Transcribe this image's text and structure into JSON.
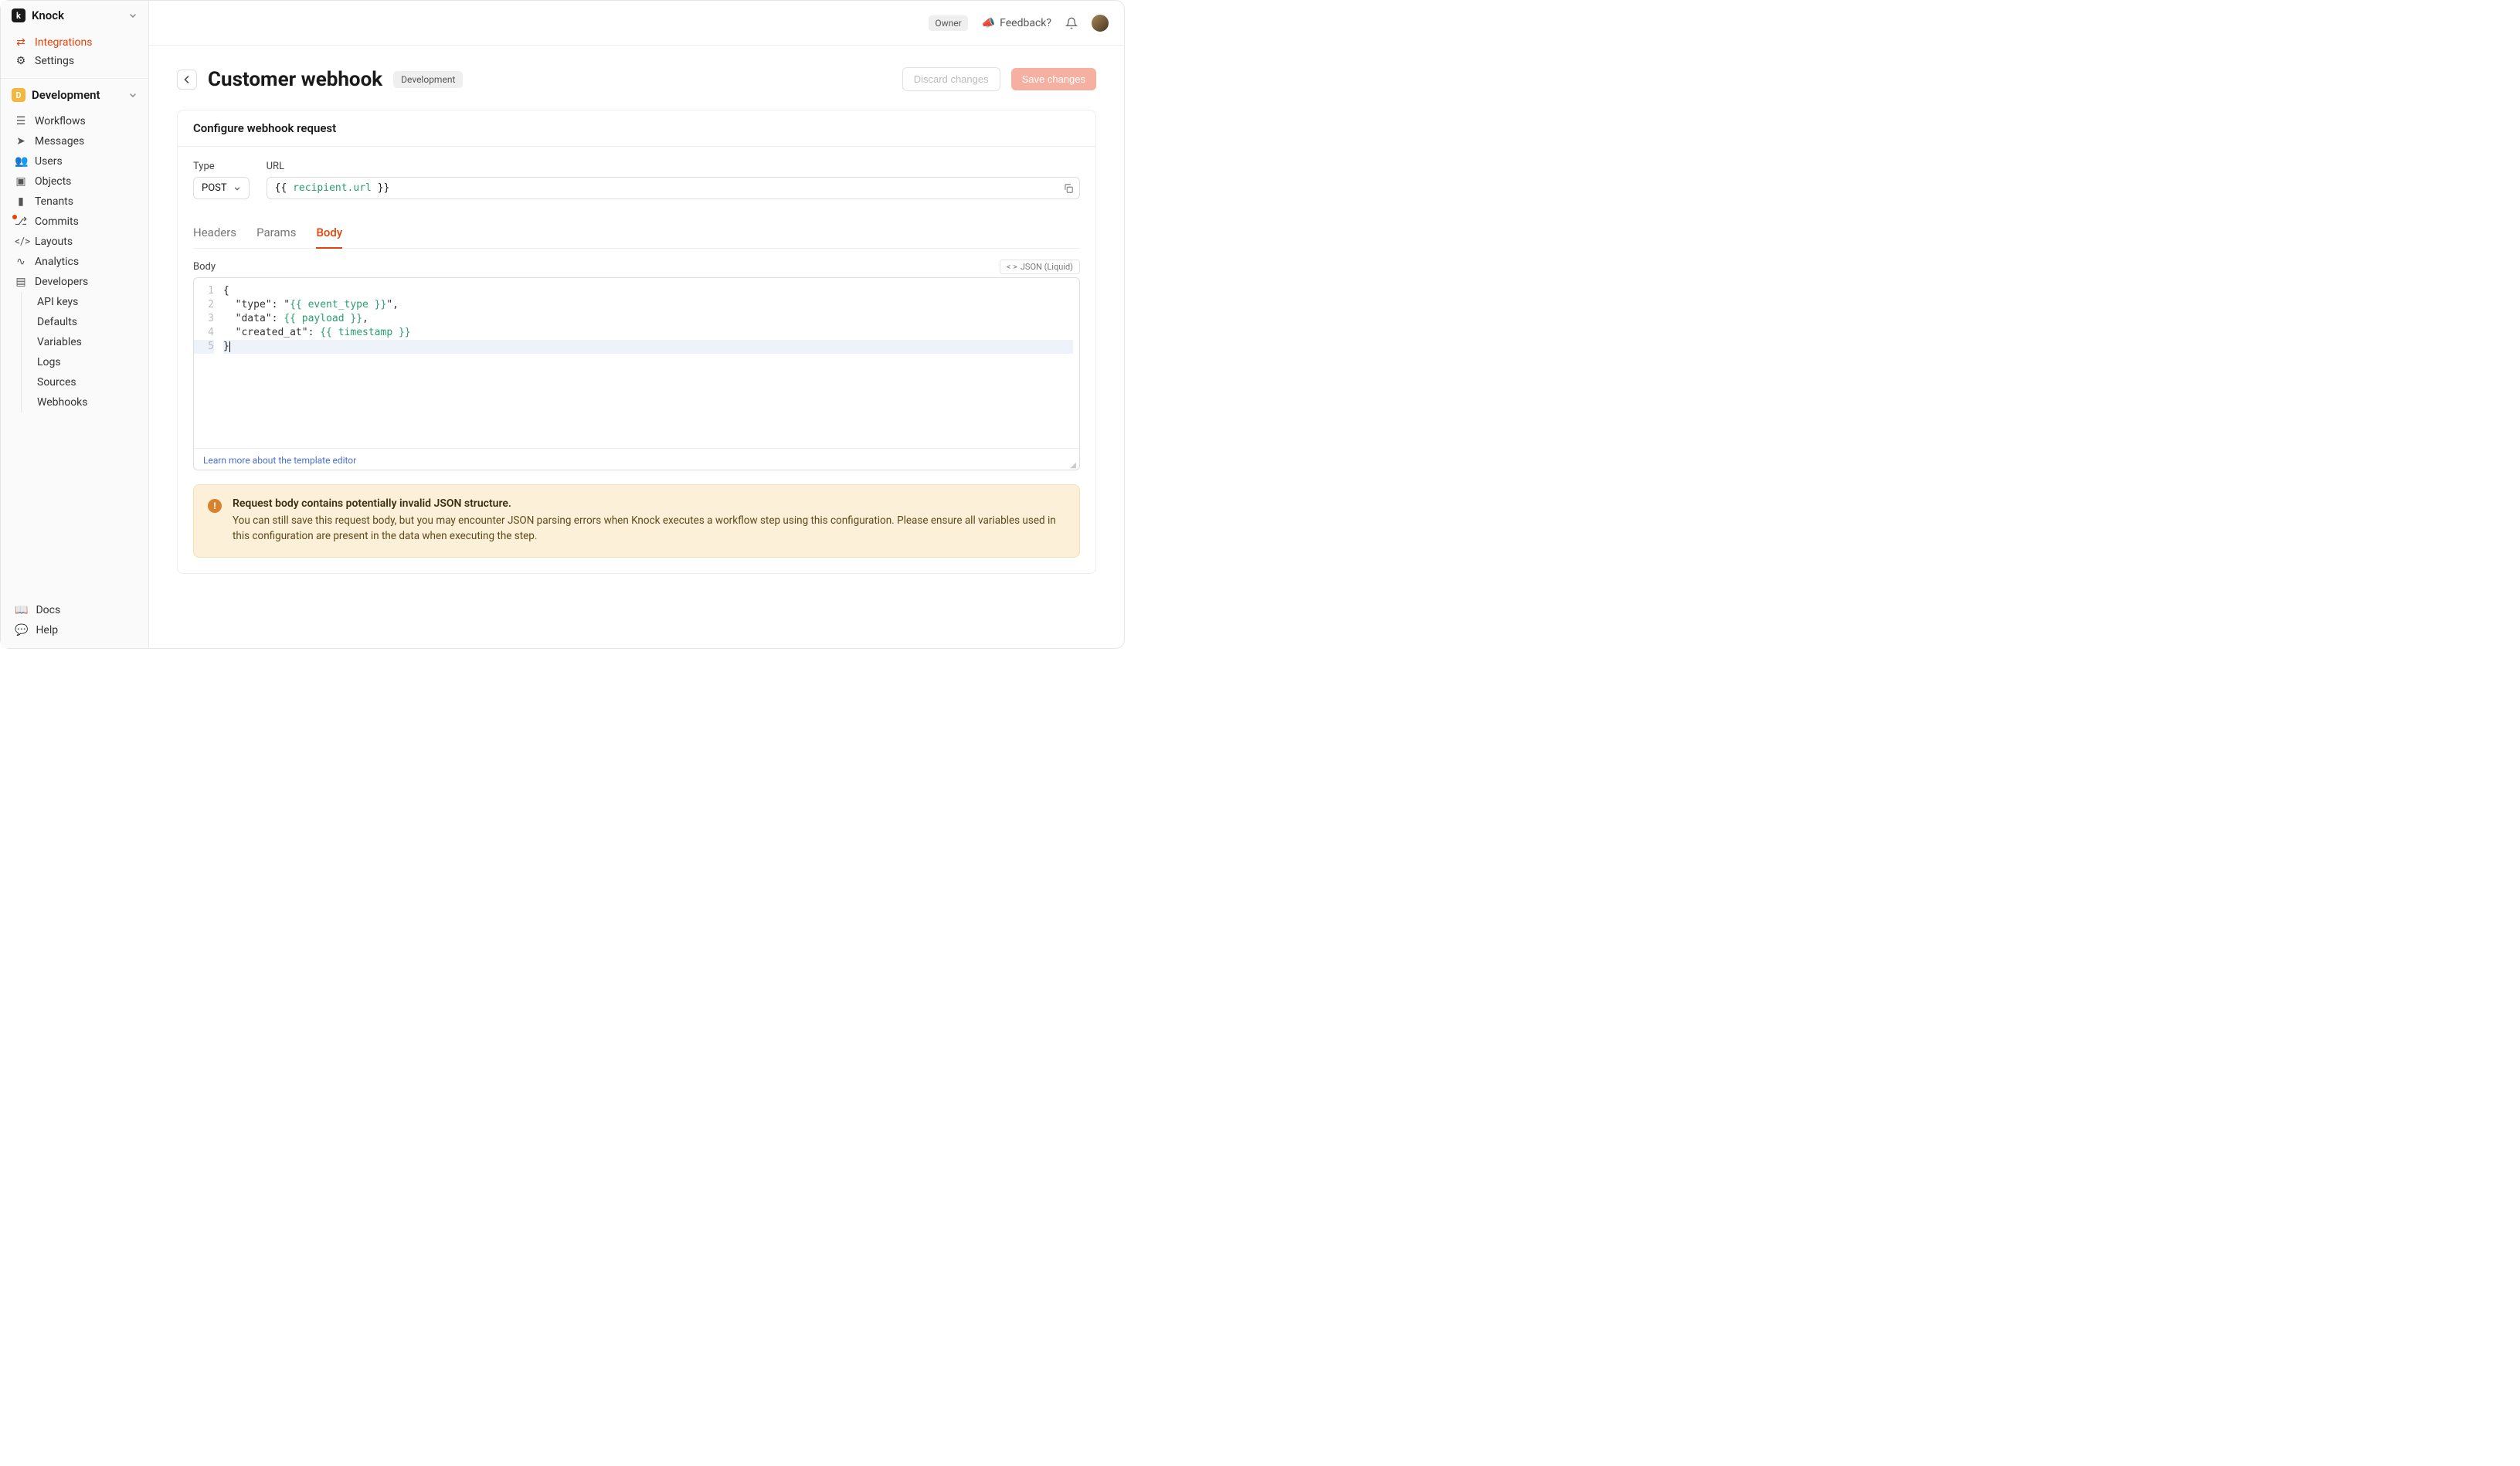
{
  "brand": "Knock",
  "topnav": {
    "integrations": "Integrations",
    "settings": "Settings"
  },
  "environment": {
    "letter": "D",
    "name": "Development"
  },
  "nav": {
    "workflows": "Workflows",
    "messages": "Messages",
    "users": "Users",
    "objects": "Objects",
    "tenants": "Tenants",
    "commits": "Commits",
    "layouts": "Layouts",
    "analytics": "Analytics",
    "developers": "Developers"
  },
  "devSub": {
    "apikeys": "API keys",
    "defaults": "Defaults",
    "variables": "Variables",
    "logs": "Logs",
    "sources": "Sources",
    "webhooks": "Webhooks"
  },
  "footer": {
    "docs": "Docs",
    "help": "Help"
  },
  "topbar": {
    "owner": "Owner",
    "feedback": "Feedback?"
  },
  "page": {
    "title": "Customer webhook",
    "env": "Development",
    "discard": "Discard changes",
    "save": "Save changes"
  },
  "panel": {
    "title": "Configure webhook request",
    "typeLabel": "Type",
    "typeValue": "POST",
    "urlLabel": "URL",
    "urlValuePrefix": "{{ ",
    "urlValueVar": "recipient.url",
    "urlValueSuffix": " }}"
  },
  "tabs": {
    "headers": "Headers",
    "params": "Params",
    "body": "Body"
  },
  "bodySection": {
    "label": "Body",
    "lang": "JSON (Liquid)",
    "learn": "Learn more about the template editor"
  },
  "code": {
    "l1": "{",
    "l2a": "  \"type\": \"",
    "l2v": "{{ event_type }}",
    "l2b": "\",",
    "l3a": "  \"data\": ",
    "l3v": "{{ payload }}",
    "l3b": ",",
    "l4a": "  \"created_at\": ",
    "l4v": "{{ timestamp }}",
    "l5": "}"
  },
  "alert": {
    "title": "Request body contains potentially invalid JSON structure.",
    "body": "You can still save this request body, but you may encounter JSON parsing errors when Knock executes a workflow step using this configuration. Please ensure all variables used in this configuration are present in the data when executing the step."
  }
}
